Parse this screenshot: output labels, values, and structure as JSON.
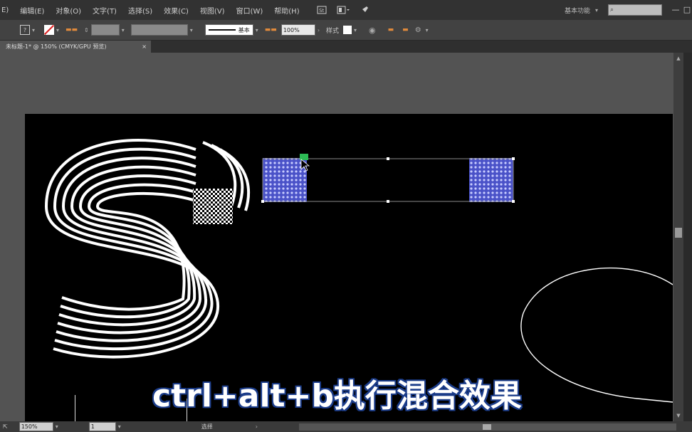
{
  "menubar": {
    "items": [
      "E)",
      "编辑(E)",
      "对象(O)",
      "文字(T)",
      "选择(S)",
      "效果(C)",
      "视图(V)",
      "窗口(W)",
      "帮助(H)"
    ],
    "workspace": "基本功能",
    "search_placeholder": "",
    "icons": [
      "br-icon",
      "arrange-documents-icon",
      "gpu-rocket-icon"
    ]
  },
  "controlbar": {
    "stroke_style_label": "基本",
    "opacity_value": "100%",
    "style_label": "样式"
  },
  "document_tab": {
    "title": "未标题-1* @ 150% (CMYK/GPU 预览)",
    "close": "×"
  },
  "caption": {
    "text": "ctrl+alt+b执行混合效果"
  },
  "statusbar": {
    "zoom": "150%",
    "page": "1",
    "tool": "选择"
  },
  "colors": {
    "app_bg": "#535353",
    "menubar_bg": "#323232",
    "artboard_bg": "#000000",
    "selection_fill": "#5b63d6",
    "caption_outline": "#1b3c8a"
  }
}
